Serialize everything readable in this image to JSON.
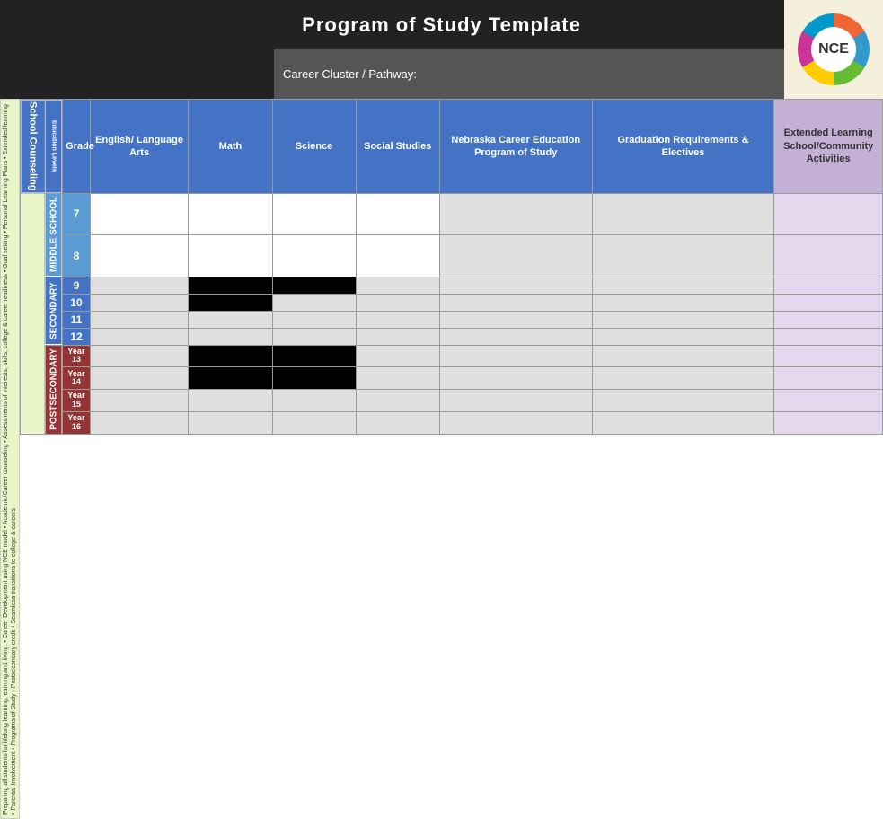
{
  "banner": {
    "title": "Program of Study Template",
    "logo_text": "NCE"
  },
  "sub_header": {
    "right_text": "Career Cluster / Pathway:"
  },
  "school_counseling_label": "School Counseling",
  "edu_levels_label": "Education Levels",
  "grade_label": "Grade",
  "columns": {
    "english": "English/ Language Arts",
    "math": "Math",
    "science": "Science",
    "social_studies": "Social Studies",
    "nce": "Nebraska Career Education Program of Study",
    "grad": "Graduation Requirements & Electives",
    "extended": "Extended Learning School/Community Activities"
  },
  "levels": {
    "middle_school": "MIDDLE SCHOOL",
    "secondary": "SECONDARY",
    "postsecondary": "POSTSECONDARY"
  },
  "grades": {
    "middle": [
      "7",
      "8"
    ],
    "secondary": [
      "9",
      "10",
      "11",
      "12"
    ],
    "postsecondary": [
      "Year\n13",
      "Year\n14",
      "Year\n15",
      "Year\n16"
    ]
  },
  "left_label": {
    "top": "Preparing all students for lifelong learning, earning and living.",
    "bullets": "• Career Development using NCE model • Academic/Career counseling • Assessments of interests, skills, college & career readiness • Goal setting • Personal Learning Plans • Extended learning • Parental Involvement • Programs of Study • Postsecondary credit • Seamless transitions to college & careers"
  }
}
